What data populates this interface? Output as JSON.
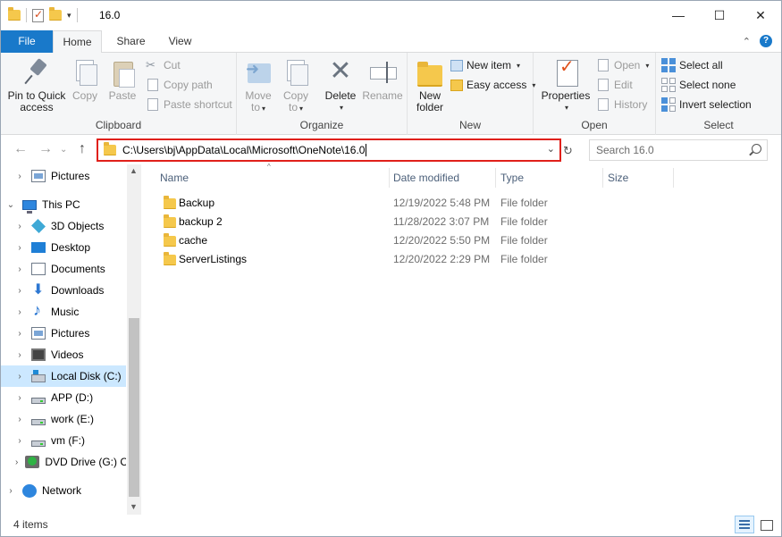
{
  "window": {
    "title": "16.0",
    "controls": {
      "minimize": "—",
      "maximize": "☐",
      "close": "✕"
    }
  },
  "ribbon_tabs": [
    "File",
    "Home",
    "Share",
    "View"
  ],
  "ribbon": {
    "clipboard": {
      "label": "Clipboard",
      "pin_line1": "Pin to Quick",
      "pin_line2": "access",
      "copy": "Copy",
      "paste": "Paste",
      "cut": "Cut",
      "copy_path": "Copy path",
      "paste_shortcut": "Paste shortcut"
    },
    "organize": {
      "label": "Organize",
      "move_line1": "Move",
      "move_line2": "to",
      "copy_line1": "Copy",
      "copy_line2": "to",
      "delete": "Delete",
      "rename": "Rename"
    },
    "new": {
      "label": "New",
      "new_folder_line1": "New",
      "new_folder_line2": "folder",
      "new_item": "New item",
      "easy_access": "Easy access"
    },
    "open": {
      "label": "Open",
      "properties": "Properties",
      "open": "Open",
      "edit": "Edit",
      "history": "History"
    },
    "select": {
      "label": "Select",
      "select_all": "Select all",
      "select_none": "Select none",
      "invert_selection": "Invert selection"
    }
  },
  "address_bar": {
    "path": "C:\\Users\\bj\\AppData\\Local\\Microsoft\\OneNote\\16.0",
    "highlight_color": "#e0201a"
  },
  "search": {
    "placeholder": "Search 16.0"
  },
  "nav_pane": {
    "items": [
      {
        "label": "Pictures",
        "icon": "pictures-icon",
        "level": 1,
        "chevron": "›"
      },
      {
        "label": "This PC",
        "icon": "pc-icon",
        "level": 0,
        "chevron": "⌄"
      },
      {
        "label": "3D Objects",
        "icon": "3d-objects-icon",
        "level": 1,
        "chevron": "›"
      },
      {
        "label": "Desktop",
        "icon": "desktop-icon",
        "level": 1,
        "chevron": "›"
      },
      {
        "label": "Documents",
        "icon": "documents-icon",
        "level": 1,
        "chevron": "›"
      },
      {
        "label": "Downloads",
        "icon": "downloads-icon",
        "level": 1,
        "chevron": "›"
      },
      {
        "label": "Music",
        "icon": "music-icon",
        "level": 1,
        "chevron": "›"
      },
      {
        "label": "Pictures",
        "icon": "pictures-icon",
        "level": 1,
        "chevron": "›"
      },
      {
        "label": "Videos",
        "icon": "videos-icon",
        "level": 1,
        "chevron": "›"
      },
      {
        "label": "Local Disk (C:)",
        "icon": "local-disk-icon",
        "level": 1,
        "chevron": "›",
        "selected": true
      },
      {
        "label": "APP (D:)",
        "icon": "drive-icon",
        "level": 1,
        "chevron": "›"
      },
      {
        "label": "work (E:)",
        "icon": "drive-icon",
        "level": 1,
        "chevron": "›"
      },
      {
        "label": "vm (F:)",
        "icon": "drive-icon",
        "level": 1,
        "chevron": "›"
      },
      {
        "label": "DVD Drive (G:) C",
        "icon": "dvd-drive-icon",
        "level": 1,
        "chevron": "›"
      },
      {
        "label": "Network",
        "icon": "network-icon",
        "level": 0,
        "chevron": "›"
      }
    ]
  },
  "columns": {
    "name": "Name",
    "date": "Date modified",
    "type": "Type",
    "size": "Size"
  },
  "files": [
    {
      "name": "Backup",
      "date": "12/19/2022 5:48 PM",
      "type": "File folder"
    },
    {
      "name": "backup 2",
      "date": "11/28/2022 3:07 PM",
      "type": "File folder"
    },
    {
      "name": "cache",
      "date": "12/20/2022 5:50 PM",
      "type": "File folder"
    },
    {
      "name": "ServerListings",
      "date": "12/20/2022 2:29 PM",
      "type": "File folder"
    }
  ],
  "status": {
    "item_count": "4 items"
  }
}
